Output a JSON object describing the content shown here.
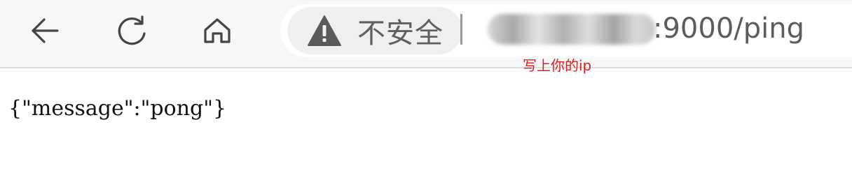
{
  "toolbar": {
    "back_icon": "arrow-left-icon",
    "reload_icon": "reload-icon",
    "home_icon": "home-icon"
  },
  "address_bar": {
    "security_icon": "warning-triangle-icon",
    "security_label": "不安全",
    "url_suffix": ":9000/ping"
  },
  "annotation": {
    "text": "写上你的ip",
    "color": "#e01b1b"
  },
  "page": {
    "body_text": "{\"message\":\"pong\"}"
  }
}
